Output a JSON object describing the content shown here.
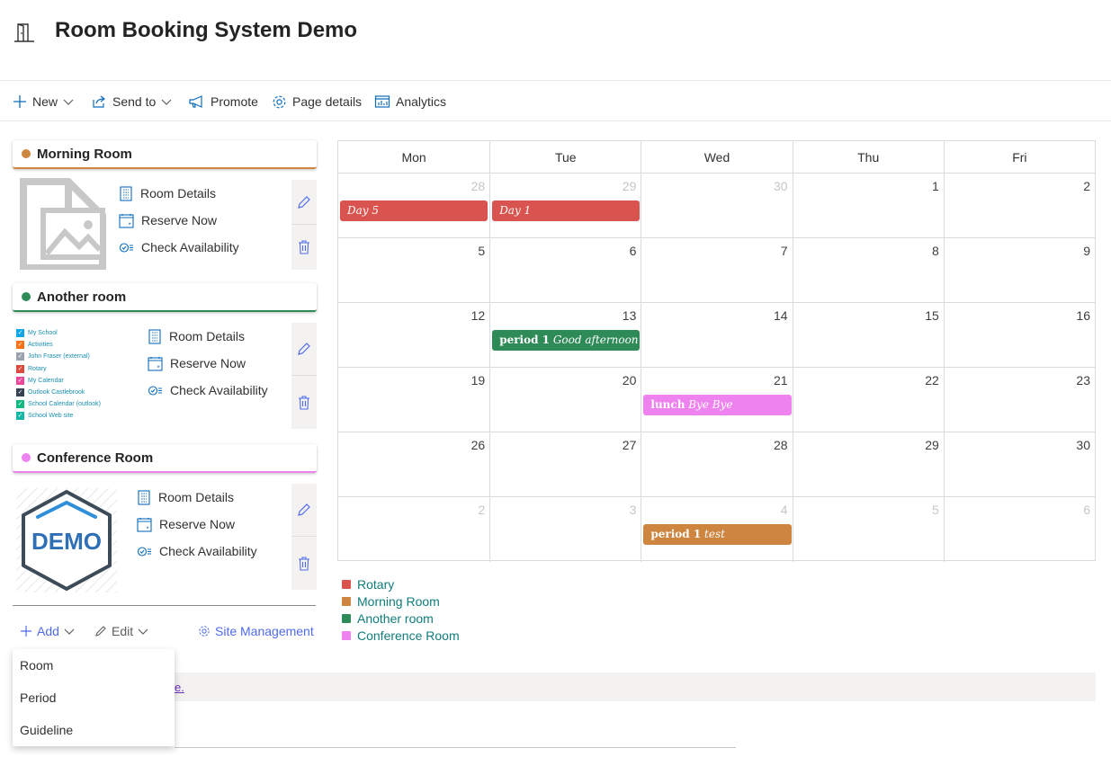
{
  "header": {
    "title": "Room Booking System Demo",
    "icon": "door-icon"
  },
  "commandbar": {
    "new_label": "New",
    "send_label": "Send to",
    "promote_label": "Promote",
    "page_details_label": "Page details",
    "analytics_label": "Analytics"
  },
  "rooms": [
    {
      "name": "Morning Room",
      "color": "#cd853f",
      "links": [
        "Room Details",
        "Reserve Now",
        "Check Availability"
      ]
    },
    {
      "name": "Another room",
      "color": "#2e8b57",
      "links": [
        "Room Details",
        "Reserve Now",
        "Check Availability"
      ]
    },
    {
      "name": "Conference Room",
      "color": "#ee82ee",
      "links": [
        "Room Details",
        "Reserve Now",
        "Check Availability"
      ]
    }
  ],
  "calendar_list": [
    {
      "label": "My School",
      "color": "#0ea5e9"
    },
    {
      "label": "Activities",
      "color": "#f97316"
    },
    {
      "label": "John Fraser (external)",
      "color": "#9ca3af"
    },
    {
      "label": "Rotary",
      "color": "#dc4a3d"
    },
    {
      "label": "My Calendar",
      "color": "#ec4899"
    },
    {
      "label": "Outlook Castlebrook",
      "color": "#374151"
    },
    {
      "label": "School Calendar (outlook)",
      "color": "#10b981"
    },
    {
      "label": "School Web site",
      "color": "#14b8a6"
    }
  ],
  "demo_logo_text": "DEMO",
  "left_toolbar": {
    "add_label": "Add",
    "edit_label": "Edit",
    "site_management_label": "Site Management"
  },
  "add_menu": [
    "Room",
    "Period",
    "Guideline"
  ],
  "band_fragment": "e.",
  "calendar": {
    "days": [
      "Mon",
      "Tue",
      "Wed",
      "Thu",
      "Fri"
    ],
    "weeks": [
      [
        {
          "d": "28",
          "other": true
        },
        {
          "d": "29",
          "other": true
        },
        {
          "d": "30",
          "other": true
        },
        {
          "d": "1"
        },
        {
          "d": "2"
        }
      ],
      [
        {
          "d": "5"
        },
        {
          "d": "6"
        },
        {
          "d": "7"
        },
        {
          "d": "8"
        },
        {
          "d": "9"
        }
      ],
      [
        {
          "d": "12"
        },
        {
          "d": "13"
        },
        {
          "d": "14"
        },
        {
          "d": "15"
        },
        {
          "d": "16"
        }
      ],
      [
        {
          "d": "19"
        },
        {
          "d": "20"
        },
        {
          "d": "21"
        },
        {
          "d": "22"
        },
        {
          "d": "23"
        }
      ],
      [
        {
          "d": "26"
        },
        {
          "d": "27"
        },
        {
          "d": "28"
        },
        {
          "d": "29"
        },
        {
          "d": "30"
        }
      ],
      [
        {
          "d": "2",
          "other": true
        },
        {
          "d": "3",
          "other": true
        },
        {
          "d": "4",
          "other": true
        },
        {
          "d": "5",
          "other": true
        },
        {
          "d": "6",
          "other": true
        }
      ]
    ],
    "events": [
      {
        "week": 0,
        "day": 0,
        "bold": "",
        "italic": "Day 5",
        "color": "#d9534f"
      },
      {
        "week": 0,
        "day": 1,
        "bold": "",
        "italic": "Day 1",
        "color": "#d9534f"
      },
      {
        "week": 2,
        "day": 1,
        "bold": "period 1",
        "italic": "Good afternoon",
        "color": "#2e8b57"
      },
      {
        "week": 3,
        "day": 2,
        "bold": "lunch",
        "italic": "Bye Bye",
        "color": "#ee82ee"
      },
      {
        "week": 5,
        "day": 2,
        "bold": "period 1",
        "italic": "test",
        "color": "#cd853f"
      }
    ]
  },
  "legend": [
    {
      "label": "Rotary",
      "color": "#d9534f"
    },
    {
      "label": "Morning Room",
      "color": "#cd853f"
    },
    {
      "label": "Another room",
      "color": "#2e8b57"
    },
    {
      "label": "Conference Room",
      "color": "#ee82ee"
    }
  ]
}
